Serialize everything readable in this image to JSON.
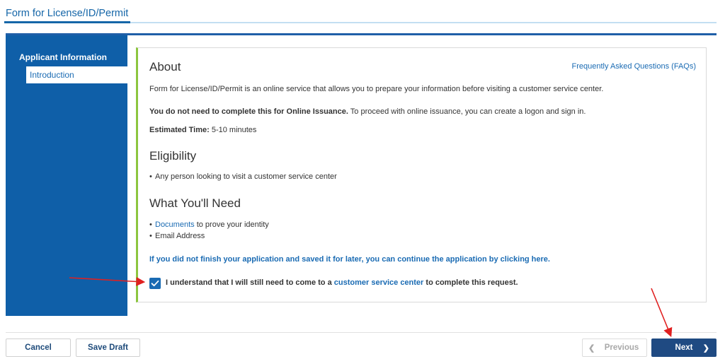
{
  "header": {
    "title": "Form for License/ID/Permit"
  },
  "sidebar": {
    "heading": "Applicant Information",
    "items": [
      {
        "label": "Introduction"
      }
    ]
  },
  "content": {
    "about_heading": "About",
    "faq_link": "Frequently Asked Questions (FAQs)",
    "about_text": "Form for License/ID/Permit is an online service that allows you to prepare your information before visiting a customer service center.",
    "notice_bold": "You do not need to complete this for Online Issuance.",
    "notice_rest": " To proceed with online issuance, you can create a logon and sign in.",
    "estimated_label": "Estimated Time:",
    "estimated_value": " 5-10 minutes",
    "eligibility_heading": "Eligibility",
    "eligibility_items": [
      "Any person looking to visit a customer service center"
    ],
    "need_heading": "What You'll Need",
    "need_items": [
      {
        "link": "Documents",
        "text": " to prove your identity"
      },
      {
        "text": "Email Address"
      }
    ],
    "continue_link": "If you did not finish your application and saved it for later, you can continue the application by clicking here.",
    "ack_prefix": "I understand that I will still need to come to a ",
    "ack_link": "customer service center",
    "ack_suffix": " to complete this request.",
    "ack_checked": true
  },
  "footer": {
    "cancel": "Cancel",
    "save_draft": "Save Draft",
    "previous": "Previous",
    "next": "Next"
  },
  "colors": {
    "sidebar": "#0f5fa8",
    "link": "#1a6bb3",
    "card_accent": "#8cc63f",
    "next_button": "#1f4a82",
    "annotation_arrow": "#e02020"
  },
  "icons": {
    "checkbox": "checkmark-icon",
    "previous": "chevron-left-icon",
    "next": "chevron-right-icon"
  }
}
